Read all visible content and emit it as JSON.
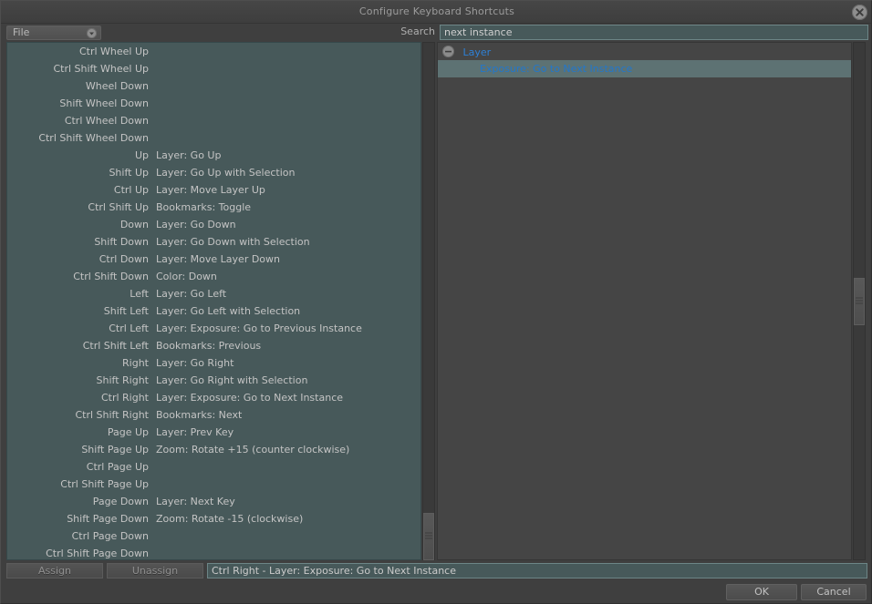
{
  "window": {
    "title": "Configure Keyboard Shortcuts",
    "close_icon": "close-circle-icon"
  },
  "toolbar": {
    "file_combo_label": "File",
    "file_combo_icon": "chevron-down-circle-icon",
    "search_label": "Search",
    "search_value": "next instance",
    "search_placeholder": "Search"
  },
  "colors": {
    "panel_bg": "#3f3f3f",
    "list_bg": "#47595a",
    "tree_bg": "#454545",
    "accent_blue": "#2e80d6",
    "selection_bar": "#5d7273",
    "text": "#c4c4c4"
  },
  "shortcut_list": {
    "rows": [
      {
        "keys": "Ctrl Wheel Up",
        "action": ""
      },
      {
        "keys": "Ctrl Shift Wheel Up",
        "action": ""
      },
      {
        "keys": "Wheel Down",
        "action": ""
      },
      {
        "keys": "Shift Wheel Down",
        "action": ""
      },
      {
        "keys": "Ctrl Wheel Down",
        "action": ""
      },
      {
        "keys": "Ctrl Shift Wheel Down",
        "action": ""
      },
      {
        "keys": "Up",
        "action": "Layer: Go Up"
      },
      {
        "keys": "Shift Up",
        "action": "Layer: Go Up with Selection"
      },
      {
        "keys": "Ctrl Up",
        "action": "Layer: Move Layer Up"
      },
      {
        "keys": "Ctrl Shift Up",
        "action": "Bookmarks: Toggle"
      },
      {
        "keys": "Down",
        "action": "Layer: Go Down"
      },
      {
        "keys": "Shift Down",
        "action": "Layer: Go Down with Selection"
      },
      {
        "keys": "Ctrl Down",
        "action": "Layer: Move Layer Down"
      },
      {
        "keys": "Ctrl Shift Down",
        "action": "Color: Down"
      },
      {
        "keys": "Left",
        "action": "Layer: Go Left"
      },
      {
        "keys": "Shift Left",
        "action": "Layer: Go Left with Selection"
      },
      {
        "keys": "Ctrl Left",
        "action": "Layer: Exposure: Go to Previous Instance"
      },
      {
        "keys": "Ctrl Shift Left",
        "action": "Bookmarks: Previous"
      },
      {
        "keys": "Right",
        "action": "Layer: Go Right"
      },
      {
        "keys": "Shift Right",
        "action": "Layer: Go Right with Selection"
      },
      {
        "keys": "Ctrl Right",
        "action": "Layer: Exposure: Go to Next Instance"
      },
      {
        "keys": "Ctrl Shift Right",
        "action": "Bookmarks: Next"
      },
      {
        "keys": "Page Up",
        "action": "Layer: Prev Key"
      },
      {
        "keys": "Shift Page Up",
        "action": "Zoom: Rotate +15 (counter clockwise)"
      },
      {
        "keys": "Ctrl Page Up",
        "action": ""
      },
      {
        "keys": "Ctrl Shift Page Up",
        "action": ""
      },
      {
        "keys": "Page Down",
        "action": "Layer: Next Key"
      },
      {
        "keys": "Shift Page Down",
        "action": "Zoom: Rotate -15 (clockwise)"
      },
      {
        "keys": "Ctrl Page Down",
        "action": ""
      },
      {
        "keys": "Ctrl Shift Page Down",
        "action": ""
      }
    ]
  },
  "command_tree": {
    "group_label": "Layer",
    "group_expander_icon": "minus-circle-icon",
    "selected_item": "Exposure: Go to Next Instance"
  },
  "action_bar": {
    "assign_label": "Assign",
    "unassign_label": "Unassign",
    "status_text": "Ctrl Right - Layer: Exposure: Go to Next Instance"
  },
  "footer": {
    "ok_label": "OK",
    "cancel_label": "Cancel"
  }
}
